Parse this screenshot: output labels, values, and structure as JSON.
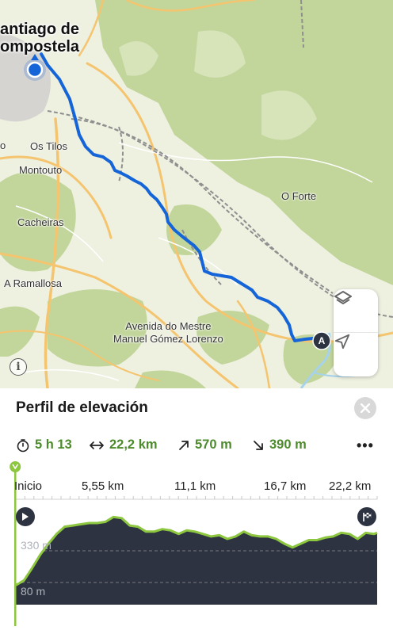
{
  "map": {
    "places": [
      {
        "name": "city-label",
        "text": "antiago de\nompostela"
      },
      {
        "name": "place-os-tilos",
        "text": "Os Tilos"
      },
      {
        "name": "place-montouto",
        "text": "Montouto"
      },
      {
        "name": "place-cacheiras",
        "text": "Cacheiras"
      },
      {
        "name": "place-a-ramallosa",
        "text": "A Ramallosa"
      },
      {
        "name": "place-o-forte",
        "text": "O Forte"
      },
      {
        "name": "place-avenida",
        "text": "Avenida do Mestre\nManuel Gómez Lorenzo"
      },
      {
        "name": "place-edge-o",
        "text": "o"
      }
    ],
    "route_end_marker": "A",
    "icons": {
      "layers": "layers-icon",
      "locate": "locate-arrow-icon",
      "info": "info-icon",
      "location": "current-location-icon"
    },
    "colors": {
      "route": "#1565d8",
      "forest": "#c2d69b",
      "field": "#eef0e0",
      "road": "#f5c46e",
      "water": "#a6d2ea"
    }
  },
  "panel": {
    "title": "Perfil de elevación",
    "stats": {
      "duration": "5 h 13",
      "distance": "22,2 km",
      "ascent": "570 m",
      "descent": "390 m"
    },
    "more": "•••",
    "axis_ticks": [
      "Inicio",
      "5,55 km",
      "11,1 km",
      "16,7 km",
      "22,2 km"
    ],
    "elevation_labels": [
      "330 m",
      "80 m"
    ],
    "icons": {
      "start": "play-icon",
      "finish": "finish-flag-icon",
      "close": "close-icon",
      "timer": "timer-icon",
      "distance": "distance-arrows-icon",
      "ascent": "arrow-up-right-icon",
      "descent": "arrow-down-right-icon"
    },
    "colors": {
      "accent": "#4c8a2c",
      "profile_fill": "#2d3340",
      "profile_line": "#8dc63f"
    }
  },
  "chart_data": {
    "type": "area",
    "title": "Perfil de elevación",
    "xlabel": "",
    "ylabel": "",
    "x_ticks": [
      "Inicio",
      "5,55 km",
      "11,1 km",
      "16,7 km",
      "22,2 km"
    ],
    "xlim": [
      0,
      22.2
    ],
    "ylim": [
      0,
      400
    ],
    "x": [
      0,
      0.5,
      1,
      1.5,
      2,
      2.5,
      3,
      3.5,
      4,
      4.5,
      5,
      5.5,
      6,
      6.5,
      7,
      7.5,
      8,
      8.5,
      9,
      9.5,
      10,
      10.5,
      11,
      11.5,
      12,
      12.5,
      13,
      13.5,
      14,
      14.5,
      15,
      15.5,
      16,
      16.5,
      17,
      17.5,
      18,
      18.5,
      19,
      19.5,
      20,
      20.5,
      21,
      21.5,
      22,
      22.2
    ],
    "series": [
      {
        "values": [
          80,
          100,
          150,
          205,
          250,
          290,
          320,
          325,
          330,
          335,
          335,
          340,
          360,
          355,
          325,
          320,
          300,
          300,
          310,
          305,
          290,
          305,
          300,
          290,
          280,
          285,
          270,
          280,
          300,
          285,
          280,
          280,
          270,
          250,
          235,
          250,
          265,
          265,
          275,
          280,
          295,
          290,
          270,
          295,
          290,
          295
        ]
      }
    ]
  }
}
